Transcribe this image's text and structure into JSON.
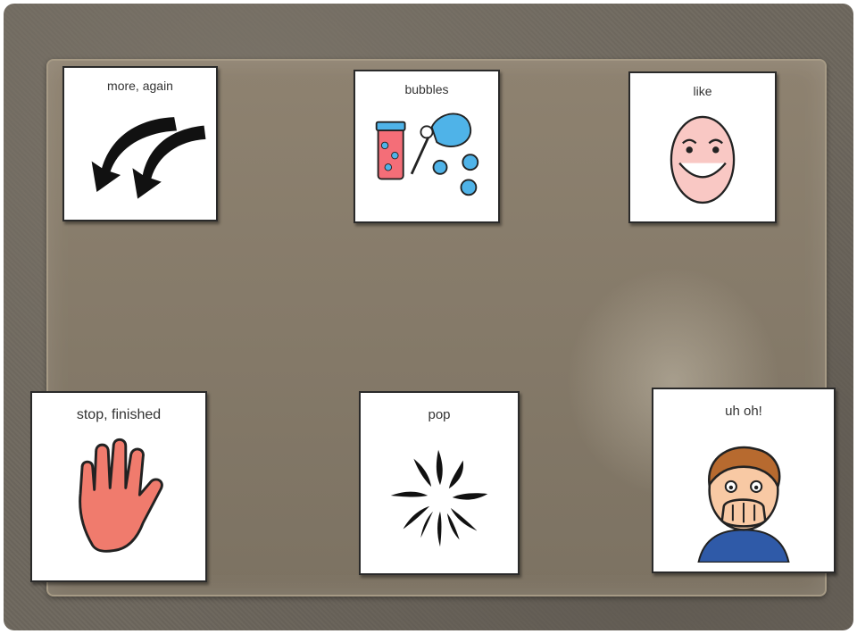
{
  "cards": [
    {
      "label": "more, again",
      "icon": "arrows-back-icon"
    },
    {
      "label": "bubbles",
      "icon": "bubbles-icon"
    },
    {
      "label": "like",
      "icon": "smiling-face-icon"
    },
    {
      "label": "stop, finished",
      "icon": "stop-hand-icon"
    },
    {
      "label": "pop",
      "icon": "pop-burst-icon"
    },
    {
      "label": "uh oh!",
      "icon": "surprised-boy-icon"
    }
  ],
  "colors": {
    "mat": "#857a69",
    "background": "#6b655c",
    "hand": "#f07b6d",
    "bubble": "#4fb3e8",
    "jar": "#f46e78"
  }
}
